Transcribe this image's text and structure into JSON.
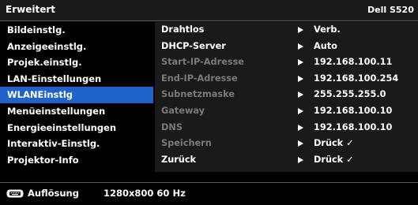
{
  "header": {
    "title": "Erweitert",
    "model": "Dell S520"
  },
  "sidebar": {
    "items": [
      {
        "label": "Bildeinstlg."
      },
      {
        "label": "Anzeigeeinstlg."
      },
      {
        "label": "Projek.einstlg."
      },
      {
        "label": "LAN-Einstellungen"
      },
      {
        "label": "WLANEinstlg"
      },
      {
        "label": "Menüeinstellungen"
      },
      {
        "label": "Energieeinstellungen"
      },
      {
        "label": "Interaktiv-Einstlg."
      },
      {
        "label": "Projektor-Info"
      }
    ],
    "selected": "WLANEinstlg"
  },
  "settings": {
    "rows": [
      {
        "label": "Drahtlos",
        "value": "Verb.",
        "enabled": true
      },
      {
        "label": "DHCP-Server",
        "value": "Auto",
        "enabled": true
      },
      {
        "label": "Start-IP-Adresse",
        "value": "192.168.100.11",
        "enabled": false
      },
      {
        "label": "End-IP-Adresse",
        "value": "192.168.100.254",
        "enabled": false
      },
      {
        "label": "Subnetzmaske",
        "value": "255.255.255.0",
        "enabled": false
      },
      {
        "label": "Gateway",
        "value": "192.168.100.10",
        "enabled": false
      },
      {
        "label": "DNS",
        "value": "192.168.100.10",
        "enabled": false
      },
      {
        "label": "Speichern",
        "value": "Drück ✓",
        "enabled": false
      },
      {
        "label": "Zurück",
        "value": "Drück ✓",
        "enabled": true
      }
    ]
  },
  "footer": {
    "icon": "keyboard-icon",
    "label": "Auflösung",
    "value": "1280x800 60 Hz"
  }
}
